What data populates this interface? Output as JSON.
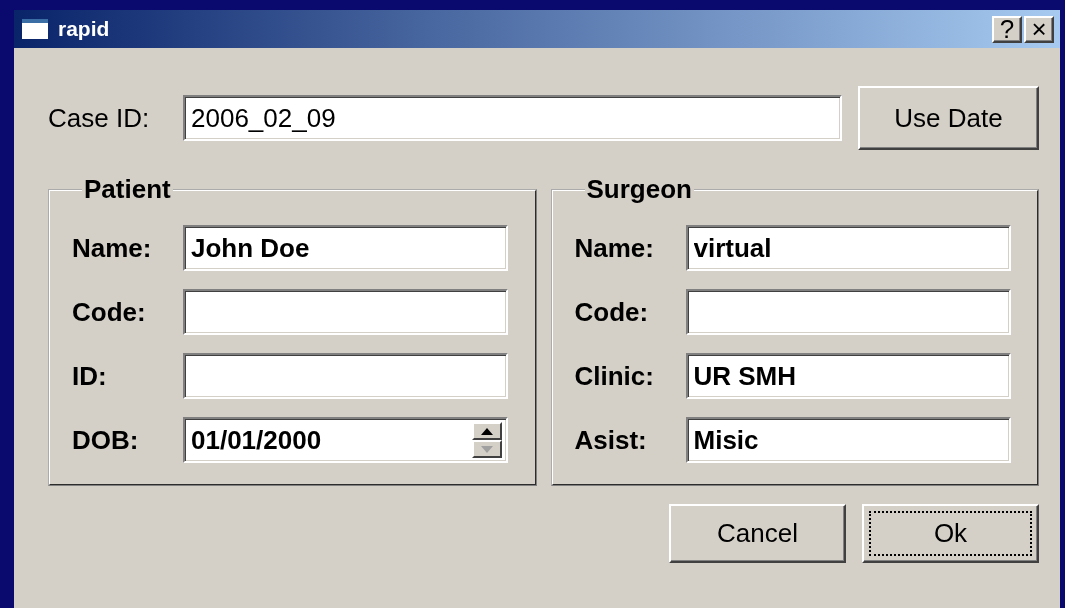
{
  "window": {
    "title": "rapid",
    "title_buttons": [
      "?",
      "×"
    ]
  },
  "case_id": {
    "label": "Case ID:",
    "value": "2006_02_09",
    "button": "Use Date"
  },
  "groups": [
    {
      "title": "Patient",
      "fields": [
        {
          "kind": "text",
          "label": "Name:",
          "value": "John Doe"
        },
        {
          "kind": "text",
          "label": "Code:"
        },
        {
          "kind": "text",
          "label": "ID:"
        },
        {
          "kind": "spin",
          "label": "DOB:",
          "value": "01/01/2000"
        }
      ]
    },
    {
      "title": "Surgeon",
      "fields": [
        {
          "kind": "text",
          "label": "Name:",
          "value": "virtual"
        },
        {
          "kind": "text",
          "label": "Code:"
        },
        {
          "kind": "text",
          "label": "Clinic:",
          "value": "UR SMH"
        },
        {
          "kind": "text",
          "label": "Asist:",
          "value": "Misic"
        }
      ]
    }
  ],
  "buttons": [
    {
      "label": "Cancel",
      "focused": false
    },
    {
      "label": "Ok",
      "focused": true
    }
  ]
}
